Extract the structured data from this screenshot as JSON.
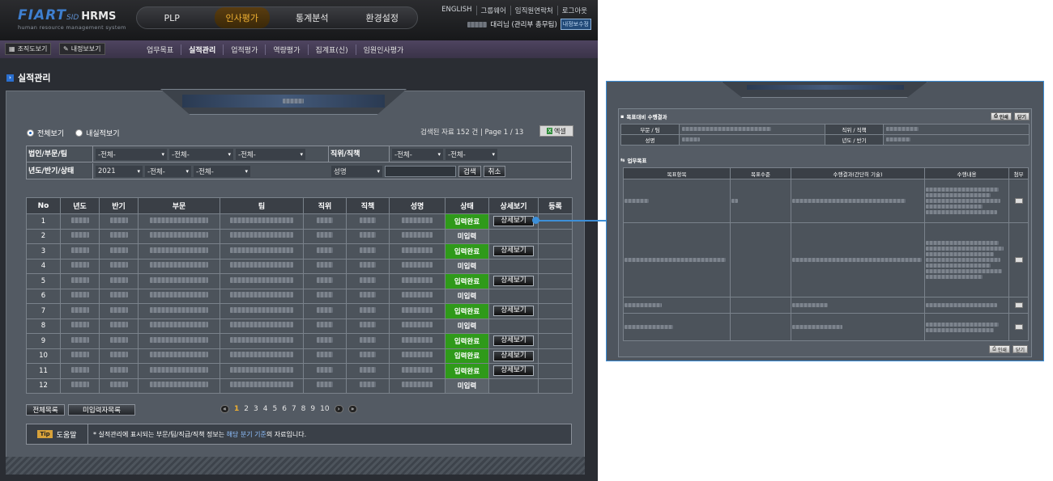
{
  "app": {
    "logo_brand": "FIART",
    "logo_sid": "SID",
    "logo_product": "HRMS",
    "logo_tagline": "human resource management system"
  },
  "main_nav": [
    "PLP",
    "인사평가",
    "통계분석",
    "환경설정"
  ],
  "util_links": [
    "ENGLISH",
    "그룹웨어",
    "임직원연락처",
    "로그아웃"
  ],
  "user": {
    "name_suffix": "대리님 (관리부 총무팀)",
    "badge": "내정보수정"
  },
  "sub_buttons": {
    "org": "조직도보기",
    "myinfo": "내정보보기"
  },
  "sub_nav": [
    "업무목표",
    "실적관리",
    "업적평가",
    "역량평가",
    "집계표(신)",
    "임원인사평가"
  ],
  "page_title": "실적관리",
  "view_options": {
    "all": "전체보기",
    "mine": "내실적보기"
  },
  "count_info": "검색된 자료 152 건  |  Page 1 / 13",
  "excel_label": "엑셀",
  "filter": {
    "label_org": "법인/부문/팀",
    "label_period": "년도/반기/상태",
    "label_pos": "직위/직책",
    "org_selects": [
      "-전체-",
      "-전체-",
      "-전체-"
    ],
    "pos_selects": [
      "-전체-",
      "-전체-"
    ],
    "year": "2021",
    "half": "-전체-",
    "state": "-전체-",
    "name_select": "성명",
    "search_btn": "검색",
    "cancel_btn": "취소"
  },
  "table": {
    "headers": [
      "No",
      "년도",
      "반기",
      "부문",
      "팀",
      "직위",
      "직책",
      "성명",
      "상태",
      "상세보기",
      "등록"
    ],
    "rows": [
      {
        "no": "1",
        "status": "입력완료",
        "detail": "상세보기",
        "done": true
      },
      {
        "no": "2",
        "status": "미입력",
        "detail": "",
        "done": false
      },
      {
        "no": "3",
        "status": "입력완료",
        "detail": "상세보기",
        "done": true
      },
      {
        "no": "4",
        "status": "미입력",
        "detail": "",
        "done": false
      },
      {
        "no": "5",
        "status": "입력완료",
        "detail": "상세보기",
        "done": true
      },
      {
        "no": "6",
        "status": "미입력",
        "detail": "",
        "done": false
      },
      {
        "no": "7",
        "status": "입력완료",
        "detail": "상세보기",
        "done": true
      },
      {
        "no": "8",
        "status": "미입력",
        "detail": "",
        "done": false
      },
      {
        "no": "9",
        "status": "입력완료",
        "detail": "상세보기",
        "done": true
      },
      {
        "no": "10",
        "status": "입력완료",
        "detail": "상세보기",
        "done": true
      },
      {
        "no": "11",
        "status": "입력완료",
        "detail": "상세보기",
        "done": true
      },
      {
        "no": "12",
        "status": "미입력",
        "detail": "",
        "done": false
      }
    ]
  },
  "bottom_buttons": {
    "all_list": "전체목록",
    "pending_list": "미입력자목록"
  },
  "pager": [
    "1",
    "2",
    "3",
    "4",
    "5",
    "6",
    "7",
    "8",
    "9",
    "10"
  ],
  "tip": {
    "tag": "Tip",
    "label": "도움말",
    "text_before": "* 실적관리에 표시되는 부문/팀/직급/직책 정보는 ",
    "text_highlight": "해당 분기 기준",
    "text_after": "의 자료입니다."
  },
  "popup": {
    "title": "목표대비 수행결과",
    "print_btn": "인쇄",
    "close_btn": "닫기",
    "info_labels": {
      "dept": "부문 / 팀",
      "pos": "직위 / 직책",
      "name": "성명",
      "period": "년도 / 반기"
    },
    "section_title": "업무목표",
    "obj_headers": [
      "목표항목",
      "목표수준",
      "수행결과(간단히 기술)",
      "수행내용",
      "첨부"
    ]
  },
  "colors": {
    "done": "#2f9a1a",
    "pending": "#5b626a",
    "accent": "#3d8fd8",
    "menu_active": "#f2b233"
  }
}
